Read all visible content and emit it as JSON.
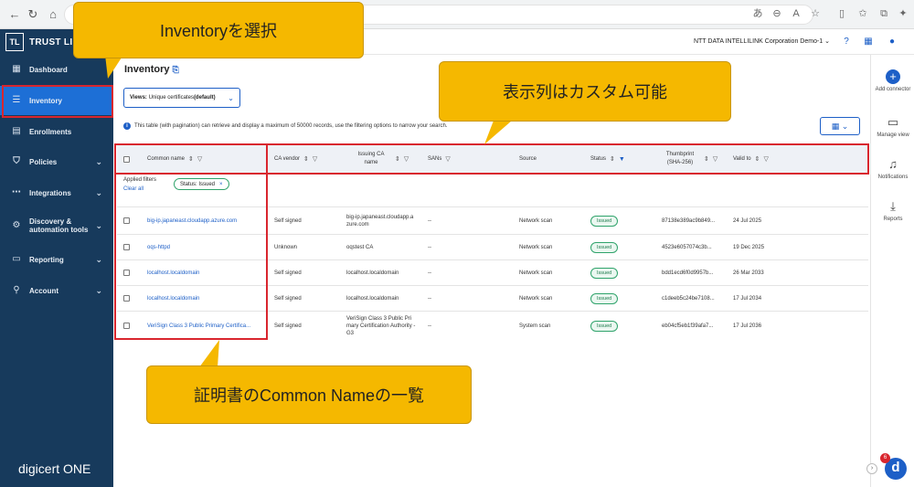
{
  "browser": {
    "address_text": ""
  },
  "sidebar": {
    "brand_badge": "TL",
    "brand_text": "TRUST LIFEC",
    "items": [
      {
        "label": "Dashboard",
        "icon": "dashboard-icon"
      },
      {
        "label": "Inventory",
        "icon": "inventory-icon"
      },
      {
        "label": "Enrollments",
        "icon": "enrollments-icon"
      },
      {
        "label": "Policies",
        "icon": "shield-icon"
      },
      {
        "label": "Integrations",
        "icon": "integrations-icon"
      },
      {
        "label": "Discovery &",
        "label2": "automation tools",
        "icon": "discovery-icon"
      },
      {
        "label": "Reporting",
        "icon": "reporting-icon"
      },
      {
        "label": "Account",
        "icon": "account-icon"
      }
    ],
    "logo_main": "digicert",
    "logo_sub": "ONE"
  },
  "header": {
    "org": "NTT DATA INTELLILINK Corporation Demo-1"
  },
  "main": {
    "title": "Inventory",
    "views_label": "Views:",
    "views_value": "Unique certificates",
    "views_default": "(default)",
    "info": "This table (with pagination) can retrieve and display a maximum of 50000 records, use the filtering options to narrow your search.",
    "applied_filters": "Applied filters",
    "clear_all": "Clear all",
    "chip": "Status: Issued"
  },
  "table": {
    "columns": [
      "Common name",
      "CA vendor",
      "Issuing CA name",
      "SANs",
      "Source",
      "Status",
      "Thumbprint (SHA-256)",
      "Valid to"
    ],
    "rows": [
      {
        "cn": "big-ip.japaneast.cloudapp.azure.com",
        "vendor": "Self signed",
        "issuing": "big-ip.japaneast.cloudapp.azure.com",
        "sans": "--",
        "source": "Network scan",
        "status": "Issued",
        "thumb": "87138e389ac9b849...",
        "valid": "24 Jul 2025"
      },
      {
        "cn": "oqs-httpd",
        "vendor": "Unknown",
        "issuing": "oqstest CA",
        "sans": "--",
        "source": "Network scan",
        "status": "Issued",
        "thumb": "4523e6057074c3b...",
        "valid": "19 Dec 2025"
      },
      {
        "cn": "localhost.localdomain",
        "vendor": "Self signed",
        "issuing": "localhost.localdomain",
        "sans": "--",
        "source": "Network scan",
        "status": "Issued",
        "thumb": "bdd1ecd6f0d9957b...",
        "valid": "26 Mar 2033"
      },
      {
        "cn": "localhost.localdomain",
        "vendor": "Self signed",
        "issuing": "localhost.localdomain",
        "sans": "--",
        "source": "Network scan",
        "status": "Issued",
        "thumb": "c1deeb5c24be7108...",
        "valid": "17 Jul 2034"
      },
      {
        "cn": "VeriSign Class 3 Public Primary Certifica...",
        "vendor": "Self signed",
        "issuing": "VeriSign Class 3 Public Primary Certification Authority - G3",
        "sans": "--",
        "source": "System scan",
        "status": "Issued",
        "thumb": "eb04cf5eb1f39afa7...",
        "valid": "17 Jul 2036"
      }
    ]
  },
  "rail": {
    "add_connector": "Add connector",
    "manage_view": "Manage view",
    "notifications": "Notifications",
    "reports": "Reports",
    "help_letter": "d",
    "help_badge": "6"
  },
  "annotations": {
    "inventory": "Inventoryを選択",
    "columns": "表示列はカスタム可能",
    "common_name": "証明書のCommon Nameの一覧"
  },
  "colors": {
    "sidebar": "#173a5c",
    "active": "#1d6fd6",
    "accent": "#1d5fc7",
    "callout": "#f5b800",
    "highlight": "#d9262e"
  }
}
